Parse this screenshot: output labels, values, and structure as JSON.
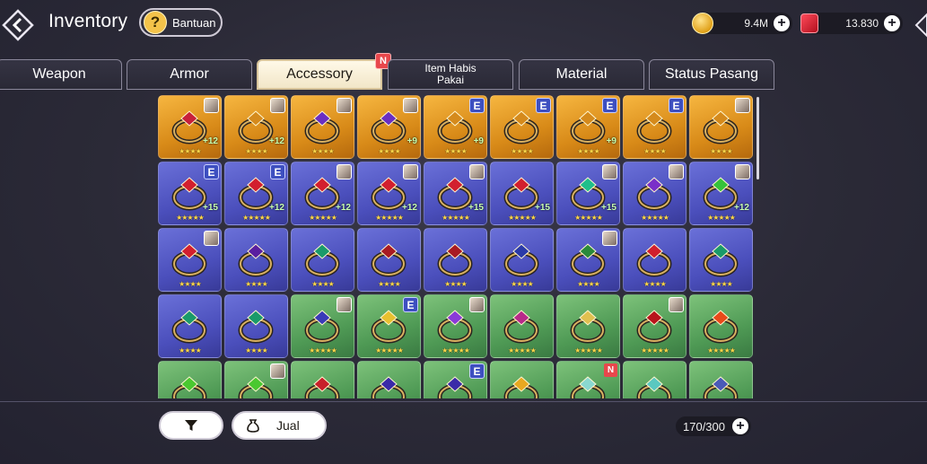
{
  "header": {
    "title": "Inventory",
    "help_label": "Bantuan",
    "help_icon": "?",
    "gold_value": "9.4M",
    "gem_value": "13.830",
    "plus_glyph": "+"
  },
  "tabs": [
    {
      "label": "Weapon"
    },
    {
      "label": "Armor"
    },
    {
      "label": "Accessory",
      "badge": "N"
    },
    {
      "label": "Item Habis Pakai"
    },
    {
      "label": "Material"
    },
    {
      "label": "Status Pasang"
    }
  ],
  "grid": {
    "items": [
      {
        "rarity": "gold",
        "gem": "#c8203a",
        "tag": "char",
        "stars": "★★★★",
        "level": "+12"
      },
      {
        "rarity": "gold",
        "gem": "#d58a1c",
        "tag": "char",
        "stars": "★★★★",
        "level": "+12"
      },
      {
        "rarity": "gold",
        "gem": "#6a2fc2",
        "tag": "char",
        "stars": "★★★★",
        "level": ""
      },
      {
        "rarity": "gold",
        "gem": "#6a2fc2",
        "tag": "char",
        "stars": "★★★★",
        "level": "+9"
      },
      {
        "rarity": "gold",
        "gem": "#d58a1c",
        "tag": "E",
        "stars": "★★★★",
        "level": "+9"
      },
      {
        "rarity": "gold",
        "gem": "#d58a1c",
        "tag": "E",
        "stars": "★★★★",
        "level": ""
      },
      {
        "rarity": "gold",
        "gem": "#d58a1c",
        "tag": "E",
        "stars": "★★★★",
        "level": "+9"
      },
      {
        "rarity": "gold",
        "gem": "#d58a1c",
        "tag": "E",
        "stars": "★★★★",
        "level": ""
      },
      {
        "rarity": "gold",
        "gem": "#d58a1c",
        "tag": "char",
        "stars": "★★★★",
        "level": ""
      },
      {
        "rarity": "purple",
        "gem": "#d21f2e",
        "tag": "E",
        "stars": "★★★★★",
        "level": "+15"
      },
      {
        "rarity": "purple",
        "gem": "#d21f2e",
        "tag": "E",
        "stars": "★★★★★",
        "level": "+12"
      },
      {
        "rarity": "purple",
        "gem": "#d21f2e",
        "tag": "char",
        "stars": "★★★★★",
        "level": "+12"
      },
      {
        "rarity": "purple",
        "gem": "#d21f2e",
        "tag": "char",
        "stars": "★★★★★",
        "level": "+12"
      },
      {
        "rarity": "purple",
        "gem": "#d21f2e",
        "tag": "char",
        "stars": "★★★★★",
        "level": "+15"
      },
      {
        "rarity": "purple",
        "gem": "#d21f2e",
        "tag": "",
        "stars": "★★★★★",
        "level": "+15"
      },
      {
        "rarity": "purple",
        "gem": "#1fbf8a",
        "tag": "char",
        "stars": "★★★★★",
        "level": "+15"
      },
      {
        "rarity": "purple",
        "gem": "#7a2fc8",
        "tag": "char",
        "stars": "★★★★★",
        "level": ""
      },
      {
        "rarity": "purple",
        "gem": "#36c23a",
        "tag": "char",
        "stars": "★★★★★",
        "level": "+12"
      },
      {
        "rarity": "purple",
        "gem": "#d21f2e",
        "tag": "char",
        "stars": "★★★★",
        "level": ""
      },
      {
        "rarity": "purple",
        "gem": "#5a1fa0",
        "tag": "",
        "stars": "★★★★",
        "level": ""
      },
      {
        "rarity": "purple",
        "gem": "#1a9a6a",
        "tag": "",
        "stars": "★★★★",
        "level": ""
      },
      {
        "rarity": "purple",
        "gem": "#a81a22",
        "tag": "",
        "stars": "★★★★",
        "level": ""
      },
      {
        "rarity": "purple",
        "gem": "#a81a22",
        "tag": "",
        "stars": "★★★★",
        "level": ""
      },
      {
        "rarity": "purple",
        "gem": "#2a3aa8",
        "tag": "",
        "stars": "★★★★",
        "level": ""
      },
      {
        "rarity": "purple",
        "gem": "#2a8a3a",
        "tag": "char",
        "stars": "★★★★",
        "level": ""
      },
      {
        "rarity": "purple",
        "gem": "#d21f2e",
        "tag": "",
        "stars": "★★★★",
        "level": ""
      },
      {
        "rarity": "purple",
        "gem": "#1a9a6a",
        "tag": "",
        "stars": "★★★★",
        "level": ""
      },
      {
        "rarity": "purple",
        "gem": "#1a9a6a",
        "tag": "",
        "stars": "★★★★",
        "level": ""
      },
      {
        "rarity": "purple",
        "gem": "#1a9a6a",
        "tag": "",
        "stars": "★★★★",
        "level": ""
      },
      {
        "rarity": "green",
        "gem": "#3a3ab8",
        "tag": "char",
        "stars": "★★★★★",
        "level": ""
      },
      {
        "rarity": "green",
        "gem": "#e8c030",
        "tag": "E",
        "stars": "★★★★★",
        "level": ""
      },
      {
        "rarity": "green",
        "gem": "#8a3ad8",
        "tag": "char",
        "stars": "★★★★★",
        "level": ""
      },
      {
        "rarity": "green",
        "gem": "#b82a8a",
        "tag": "",
        "stars": "★★★★★",
        "level": ""
      },
      {
        "rarity": "green",
        "gem": "#e0c050",
        "tag": "",
        "stars": "★★★★★",
        "level": ""
      },
      {
        "rarity": "green",
        "gem": "#b8141c",
        "tag": "char",
        "stars": "★★★★★",
        "level": ""
      },
      {
        "rarity": "green",
        "gem": "#e84a1a",
        "tag": "",
        "stars": "★★★★★",
        "level": ""
      },
      {
        "rarity": "green",
        "gem": "#4ac830",
        "tag": "",
        "stars": "",
        "level": ""
      },
      {
        "rarity": "green",
        "gem": "#4ac830",
        "tag": "char",
        "stars": "",
        "level": ""
      },
      {
        "rarity": "green",
        "gem": "#c8202a",
        "tag": "",
        "stars": "",
        "level": ""
      },
      {
        "rarity": "green",
        "gem": "#3a2aa8",
        "tag": "",
        "stars": "",
        "level": ""
      },
      {
        "rarity": "green",
        "gem": "#3a2aa8",
        "tag": "E",
        "stars": "",
        "level": ""
      },
      {
        "rarity": "green",
        "gem": "#e8a820",
        "tag": "",
        "stars": "",
        "level": ""
      },
      {
        "rarity": "green",
        "gem": "#8ad8d0",
        "tag": "N",
        "stars": "",
        "level": ""
      },
      {
        "rarity": "green",
        "gem": "#5ac8c0",
        "tag": "",
        "stars": "",
        "level": ""
      },
      {
        "rarity": "green",
        "gem": "#4a5ab8",
        "tag": "",
        "stars": "",
        "level": ""
      }
    ]
  },
  "bottom": {
    "filter_icon": "filter-icon",
    "sell_label": "Jual",
    "capacity": "170/300"
  },
  "colors": {
    "gold_rarity": "#e09a22",
    "purple_rarity": "#5a5ecb",
    "green_rarity": "#5aa860",
    "badge_red": "#e8474c",
    "e_badge": "#3d4fc0"
  }
}
